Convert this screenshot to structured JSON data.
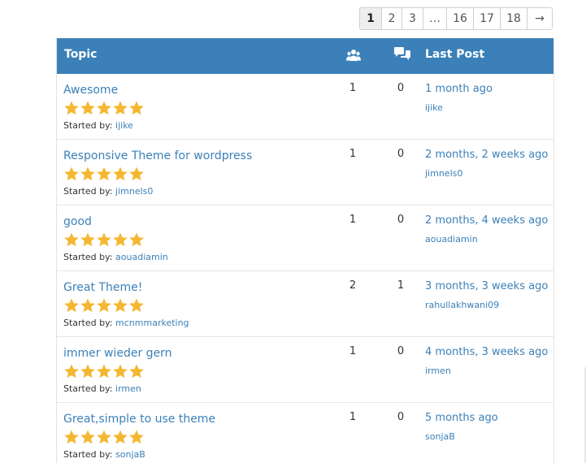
{
  "pagination": {
    "pages": [
      "1",
      "2",
      "3",
      "…",
      "16",
      "17",
      "18",
      "→"
    ],
    "current": "1"
  },
  "table": {
    "header": {
      "topic": "Topic",
      "last_post": "Last Post",
      "voices_icon": "voices-icon",
      "replies_icon": "replies-icon"
    },
    "started_by_label": "Started by:",
    "rating_color": "#f5b731",
    "accent_color": "#3b80b8",
    "rows": [
      {
        "title": "Awesome",
        "rating": 5,
        "author": "ijike",
        "voices": "1",
        "replies": "0",
        "last_time": "1 month ago",
        "last_author": "ijike"
      },
      {
        "title": "Responsive Theme for wordpress",
        "rating": 5,
        "author": "jimnels0",
        "voices": "1",
        "replies": "0",
        "last_time": "2 months, 2 weeks ago",
        "last_author": "jimnels0"
      },
      {
        "title": "good",
        "rating": 5,
        "author": "aouadiamin",
        "voices": "1",
        "replies": "0",
        "last_time": "2 months, 4 weeks ago",
        "last_author": "aouadiamin"
      },
      {
        "title": "Great Theme!",
        "rating": 5,
        "author": "mcnmmarketing",
        "voices": "2",
        "replies": "1",
        "last_time": "3 months, 3 weeks ago",
        "last_author": "rahullakhwani09"
      },
      {
        "title": "immer wieder gern",
        "rating": 5,
        "author": "irmen",
        "voices": "1",
        "replies": "0",
        "last_time": "4 months, 3 weeks ago",
        "last_author": "irmen"
      },
      {
        "title": "Great,simple to use theme",
        "rating": 5,
        "author": "sonjaB",
        "voices": "1",
        "replies": "0",
        "last_time": "5 months ago",
        "last_author": "sonjaB"
      }
    ]
  }
}
